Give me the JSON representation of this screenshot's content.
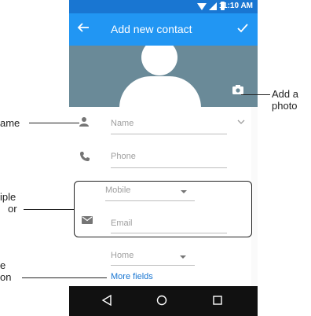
{
  "status_bar": {
    "time": "11:10 AM"
  },
  "toolbar": {
    "title": "Add new contact"
  },
  "form": {
    "name_placeholder": "Name",
    "phone_placeholder": "Phone",
    "mobile_label": "Mobile",
    "email_placeholder": "Email",
    "home_label": "Home",
    "more_fields": "More fields"
  },
  "callouts": {
    "add_photo_line1": "Add a",
    "add_photo_line2": "photo",
    "name_fragment": "ame",
    "multiple_line1": "iple",
    "multiple_line2": "or",
    "more_line1": "e",
    "more_line2": "on"
  },
  "icons": {
    "back": "arrow-left-icon",
    "save": "check-icon",
    "camera": "camera-icon",
    "person": "person-icon",
    "phone": "phone-icon",
    "email": "email-icon",
    "nav_back": "triangle-back-icon",
    "nav_home": "circle-home-icon",
    "nav_recents": "square-recents-icon"
  },
  "colors": {
    "status_bar": "#1976d2",
    "toolbar": "#2196f3",
    "photo_area": "#6a8a98",
    "link": "#1976d2"
  }
}
